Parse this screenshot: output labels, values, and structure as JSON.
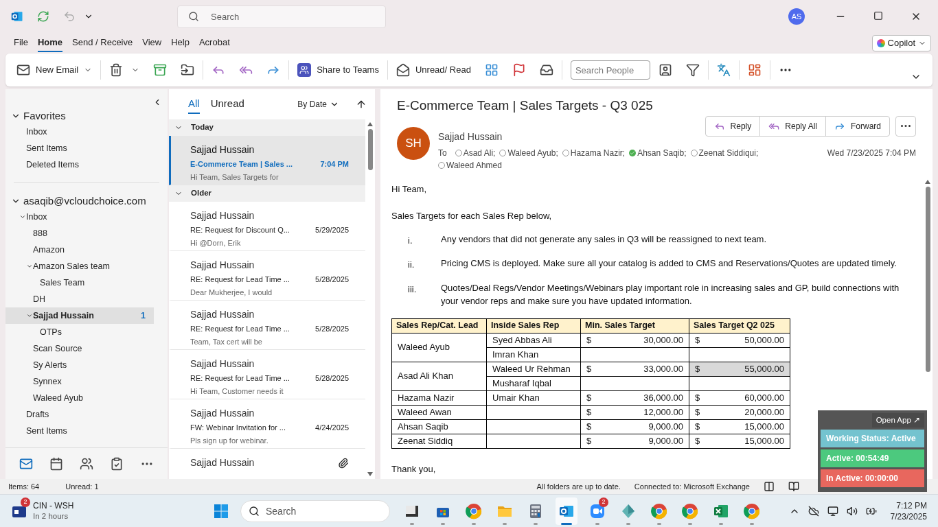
{
  "titlebar": {
    "search_placeholder": "Search",
    "avatar": "AS"
  },
  "menu": [
    {
      "label": "File",
      "selected": false
    },
    {
      "label": "Home",
      "selected": true
    },
    {
      "label": "Send / Receive",
      "selected": false
    },
    {
      "label": "View",
      "selected": false
    },
    {
      "label": "Help",
      "selected": false
    },
    {
      "label": "Acrobat",
      "selected": false
    }
  ],
  "copilot": "Copilot",
  "ribbon": {
    "new_email": "New Email",
    "share": "Share to Teams",
    "unread": "Unread/ Read",
    "search_placeholder": "Search People"
  },
  "folders": {
    "favorites": {
      "label": "Favorites",
      "expanded": true,
      "items": [
        {
          "label": "Inbox"
        },
        {
          "label": "Sent Items"
        },
        {
          "label": "Deleted Items"
        }
      ]
    },
    "account": {
      "label": "asaqib@vcloudchoice.com",
      "expanded": true,
      "items": [
        {
          "label": "Inbox",
          "expanded": true,
          "selected": false,
          "children": [
            {
              "label": "888",
              "selected": false
            },
            {
              "label": "Amazon",
              "selected": false
            },
            {
              "label": "Amazon Sales team",
              "expanded": true,
              "selected": false,
              "children": [
                {
                  "label": "Sales Team",
                  "selected": false
                }
              ]
            },
            {
              "label": "DH",
              "selected": false
            },
            {
              "label": "Sajjad Hussain",
              "expanded": true,
              "selected": true,
              "count": "1",
              "children": [
                {
                  "label": "OTPs",
                  "selected": false
                }
              ]
            },
            {
              "label": "Scan Source",
              "selected": false
            },
            {
              "label": "Sy Alerts",
              "selected": false
            },
            {
              "label": "Synnex",
              "selected": false
            },
            {
              "label": "Waleed Ayub",
              "selected": false
            }
          ]
        },
        {
          "label": "Drafts",
          "selected": false
        },
        {
          "label": "Sent Items",
          "selected": false
        }
      ]
    }
  },
  "list": {
    "tabs": [
      {
        "label": "All",
        "selected": true
      },
      {
        "label": "Unread",
        "selected": false
      }
    ],
    "sort": "By Date",
    "groups": [
      {
        "label": "Today",
        "items": [
          {
            "sender": "Sajjad Hussain",
            "subject": "E-Commerce Team | Sales ...",
            "preview": "Hi Team,  Sales Targets for",
            "date": "7:04 PM",
            "selected": true,
            "unread": true
          }
        ]
      },
      {
        "label": "Older",
        "items": [
          {
            "sender": "Sajjad Hussain",
            "subject": "RE: Request for Discount Q...",
            "preview": "Hi @Dorn, Erik",
            "date": "5/29/2025",
            "selected": false,
            "unread": false
          },
          {
            "sender": "Sajjad Hussain",
            "subject": "RE: Request for Lead Time ...",
            "preview": "Dear Mukherjee,   I would",
            "date": "5/28/2025",
            "selected": false,
            "unread": false
          },
          {
            "sender": "Sajjad Hussain",
            "subject": "RE: Request for Lead Time ...",
            "preview": "Team, Tax cert will be",
            "date": "5/28/2025",
            "selected": false,
            "unread": false
          },
          {
            "sender": "Sajjad Hussain",
            "subject": "RE: Request for Lead Time ...",
            "preview": "Hi Team,  Customer needs it",
            "date": "5/28/2025",
            "selected": false,
            "unread": false
          },
          {
            "sender": "Sajjad Hussain",
            "subject": "FW: Webinar Invitation for ...",
            "preview": "Pls sign up for webinar.",
            "date": "4/24/2025",
            "selected": false,
            "unread": false
          },
          {
            "sender": "Sajjad Hussain",
            "attachment": true,
            "selected": false,
            "unread": false
          }
        ]
      }
    ]
  },
  "message": {
    "subject": "E-Commerce Team | Sales Targets - Q3 025",
    "initials": "SH",
    "sender": "Sajjad Hussain",
    "to_label": "To",
    "date": "Wed 7/23/2025 7:04 PM",
    "recipients": [
      {
        "name": "Asad Ali;",
        "available": false
      },
      {
        "name": "Waleed Ayub;",
        "available": false
      },
      {
        "name": "Hazama Nazir;",
        "available": false
      },
      {
        "name": "Ahsan Saqib;",
        "available": true
      },
      {
        "name": "Zeenat Siddiqui;",
        "available": false
      },
      {
        "name": "Waleed Ahmed",
        "available": false
      }
    ],
    "actions": [
      "Reply",
      "Reply All",
      "Forward"
    ],
    "greeting": "Hi Team,",
    "intro": "Sales Targets for each Sales Rep below,",
    "points": [
      {
        "marker": "i.",
        "text": "Any vendors that did not generate any sales in Q3 will be reassigned to next team."
      },
      {
        "marker": "ii.",
        "text": "Pricing CMS is deployed. Make sure all your catalog is added to CMS and Reservations/Quotes are updated timely."
      },
      {
        "marker": "iii.",
        "text": "Quotes/Deal Regs/Vendor Meetings/Webinars play important role in increasing sales and GP, build connections with your vendor reps and make sure you have updated information."
      }
    ],
    "table": {
      "columns": [
        "Sales Rep/Cat. Lead",
        "Inside Sales Rep",
        "Min. Sales Target",
        "Sales Target Q2 025"
      ],
      "groups": [
        {
          "rep": "Waleed Ayub",
          "rows": [
            {
              "inside": "Syed Abbas Ali",
              "min_cur": "$",
              "min": "30,000.00",
              "target_cur": "$",
              "target": "50,000.00",
              "highlighted": false
            },
            {
              "inside": "Imran Khan",
              "highlighted": false
            }
          ]
        },
        {
          "rep": "Asad Ali Khan",
          "rows": [
            {
              "inside": "Waleed Ur Rehman",
              "min_cur": "$",
              "min": "33,000.00",
              "target_cur": "$",
              "target": "55,000.00",
              "highlighted": true
            },
            {
              "inside": "Musharaf Iqbal",
              "highlighted": false
            }
          ]
        },
        {
          "rep": "Hazama Nazir",
          "rows": [
            {
              "inside": "Umair Khan",
              "min_cur": "$",
              "min": "36,000.00",
              "target_cur": "$",
              "target": "60,000.00",
              "highlighted": false
            }
          ]
        },
        {
          "rep": "Waleed Awan",
          "rows": [
            {
              "min_cur": "$",
              "min": "12,000.00",
              "target_cur": "$",
              "target": "20,000.00",
              "highlighted": false
            }
          ]
        },
        {
          "rep": "Ahsan Saqib",
          "rows": [
            {
              "min_cur": "$",
              "min": "9,000.00",
              "target_cur": "$",
              "target": "15,000.00",
              "highlighted": false
            }
          ]
        },
        {
          "rep": "Zeenat Siddiq",
          "rows": [
            {
              "min_cur": "$",
              "min": "9,000.00",
              "target_cur": "$",
              "target": "15,000.00",
              "highlighted": false
            }
          ]
        }
      ]
    },
    "closing": "Thank you,"
  },
  "status_bar": {
    "items": "Items: 64",
    "unread": "Unread: 1",
    "sync": "All folders are up to date.",
    "connection": "Connected to: Microsoft Exchange"
  },
  "tracker": {
    "open_app": "Open App ↗",
    "bars": [
      {
        "label": "Working Status: Active",
        "color": "#74c3cf"
      },
      {
        "label": "Active: 00:54:49",
        "color": "#4cc97e"
      },
      {
        "label": "In Active: 00:00:00",
        "color": "#e8675e"
      }
    ]
  },
  "taskbar": {
    "notification": {
      "title": "CIN - WSH",
      "subtitle": "In 2 hours",
      "badge": "2"
    },
    "search_placeholder": "Search",
    "apps": [
      {
        "kind": "terminal",
        "selected": false
      },
      {
        "kind": "store",
        "selected": false
      },
      {
        "kind": "chrome",
        "selected": false
      },
      {
        "kind": "folder",
        "selected": false
      },
      {
        "kind": "calculator",
        "selected": false
      },
      {
        "kind": "outlook",
        "selected": true
      },
      {
        "kind": "zoom",
        "selected": false,
        "badge": "2"
      },
      {
        "kind": "diamond",
        "selected": false
      },
      {
        "kind": "chrome",
        "selected": false
      },
      {
        "kind": "chrome",
        "selected": false
      },
      {
        "kind": "excel",
        "selected": false
      },
      {
        "kind": "chrome",
        "selected": false
      }
    ],
    "time": "7:12 PM",
    "date": "7/23/2025"
  }
}
